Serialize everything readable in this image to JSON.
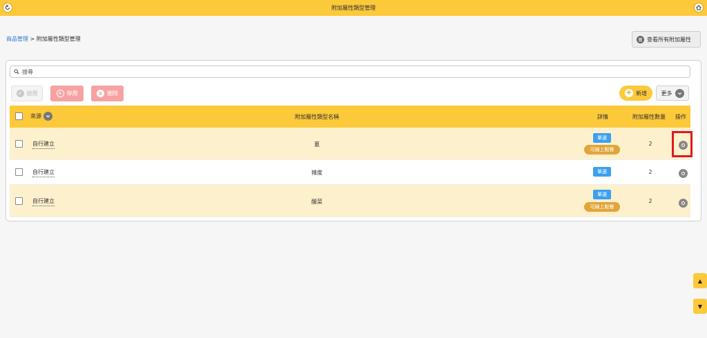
{
  "header": {
    "title": "附加屬性類型管理",
    "back_icon": "back-arrow-icon",
    "home_icon": "home-icon"
  },
  "breadcrumb": {
    "parent": "商品管理",
    "separator": ">",
    "current": "附加屬性類型管理"
  },
  "view_all_button": {
    "label": "查看所有附加屬性",
    "icon": "list-icon"
  },
  "search": {
    "placeholder": "搜尋",
    "value": ""
  },
  "toolbar": {
    "enable_label": "啟用",
    "disable_label": "停用",
    "delete_label": "刪除",
    "add_label": "新增",
    "more_label": "更多"
  },
  "table": {
    "columns": {
      "source": "來源",
      "name": "附加屬性類型名稱",
      "detail": "詳情",
      "count": "附加屬性數量",
      "ops": "操作"
    },
    "rows": [
      {
        "source": "自行建立",
        "name": "蔥",
        "type_badge": "單選",
        "online_badge": "可線上點餐",
        "count": "2"
      },
      {
        "source": "自行建立",
        "name": "辣度",
        "type_badge": "單選",
        "online_badge": "",
        "count": "2"
      },
      {
        "source": "自行建立",
        "name": "酸菜",
        "type_badge": "單選",
        "online_badge": "可線上點餐",
        "count": "2"
      }
    ]
  },
  "colors": {
    "accent": "#fcc93a",
    "row_highlight": "#fdf0cd",
    "badge_blue": "#3ba0f2",
    "badge_orange": "#e2a53a",
    "danger_soft": "#f7a2a2",
    "annotation": "#e0181d"
  },
  "scroll": {
    "up": "▲",
    "down": "▼"
  }
}
